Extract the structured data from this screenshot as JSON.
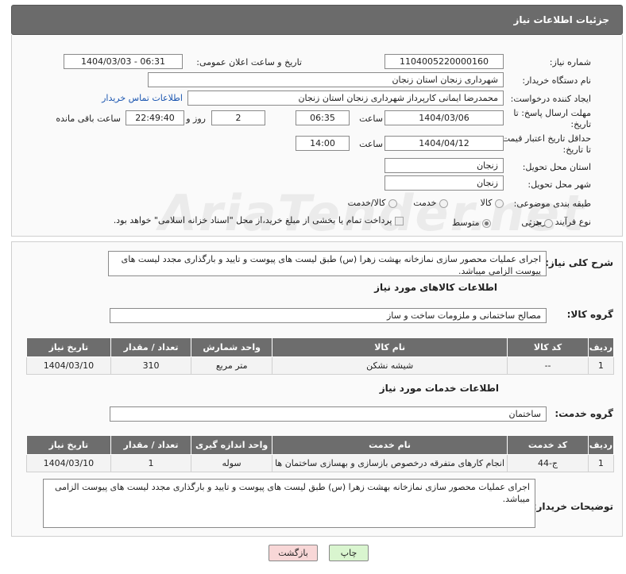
{
  "header": {
    "title": "جزئیات اطلاعات نیاز"
  },
  "form": {
    "need_number_label": "شماره نیاز:",
    "need_number": "1104005220000160",
    "announce_label": "تاریخ و ساعت اعلان عمومی:",
    "announce_value": "1404/03/03 - 06:31",
    "buyer_org_label": "نام دستگاه خریدار:",
    "buyer_org": "شهرداری زنجان استان زنجان",
    "creator_label": "ایجاد کننده درخواست:",
    "creator": "محمدرضا  ایمانی کارپرداز شهرداری زنجان استان زنجان",
    "buyer_contact_link": "اطلاعات تماس خریدار",
    "deadline_label_1": "مهلت ارسال پاسخ: تا",
    "deadline_label_2": "تاریخ:",
    "deadline_date": "1404/03/06",
    "time_label": "ساعت",
    "deadline_time": "06:35",
    "days_count": "2",
    "days_label": "روز و",
    "remaining_time": "22:49:40",
    "remaining_label": "ساعت باقی مانده",
    "price_validity_label_1": "حداقل تاریخ اعتبار قیمت:",
    "price_validity_label_2": "تا تاریخ:",
    "price_validity_date": "1404/04/12",
    "price_validity_time": "14:00",
    "province_label": "استان محل تحویل:",
    "province": "زنجان",
    "city_label": "شهر محل تحویل:",
    "city": "زنجان",
    "category_label": "طبقه بندی موضوعی:",
    "category_options": [
      "کالا",
      "خدمت",
      "کالا/خدمت"
    ],
    "process_label": "نوع فرآیند خرید :",
    "process_options": [
      "جزیی",
      "متوسط"
    ],
    "payment_note": "پرداخت تمام یا بخشی از مبلغ خرید،از محل \"اسناد خزانه اسلامی\" خواهد بود."
  },
  "description": {
    "label": "شرح کلی نیاز:",
    "text": "اجرای عملیات محصور سازی نمازخانه بهشت زهرا (س) طبق لیست های پیوست و تایید و بارگذاری مجدد لیست های پیوست الزامی میباشد."
  },
  "goods": {
    "section_title": "اطلاعات کالاهای مورد نیاز",
    "group_label": "گروه کالا:",
    "group_value": "مصالح ساختمانی و ملزومات ساخت و ساز",
    "columns": [
      "ردیف",
      "کد کالا",
      "نام کالا",
      "واحد شمارش",
      "تعداد / مقدار",
      "تاریخ نیاز"
    ],
    "rows": [
      [
        "1",
        "--",
        "شیشه نشکن",
        "متر مربع",
        "310",
        "1404/03/10"
      ]
    ]
  },
  "services": {
    "section_title": "اطلاعات خدمات مورد نیاز",
    "group_label": "گروه خدمت:",
    "group_value": "ساختمان",
    "columns": [
      "ردیف",
      "کد خدمت",
      "نام خدمت",
      "واحد اندازه گیری",
      "تعداد / مقدار",
      "تاریخ نیاز"
    ],
    "rows": [
      [
        "1",
        "ج-44",
        "انجام کارهای متفرقه درخصوص بازسازی و بهسازی ساختمان ها",
        "سوله",
        "1",
        "1404/03/10"
      ]
    ]
  },
  "buyer_notes": {
    "label": "توضیحات خریدار:",
    "text": "اجرای عملیات محصور سازی نمازخانه بهشت زهرا (س) طبق لیست های پیوست و تایید و بارگذاری مجدد لیست های پیوست الزامی میباشد."
  },
  "buttons": {
    "print": "چاپ",
    "back": "بازگشت"
  },
  "watermark": "AriaTender.net",
  "colors": {
    "header_bg": "#6b6b6b",
    "link": "#1a55b0",
    "print_btn": "#d9f5cf",
    "back_btn": "#f8d7d7"
  }
}
